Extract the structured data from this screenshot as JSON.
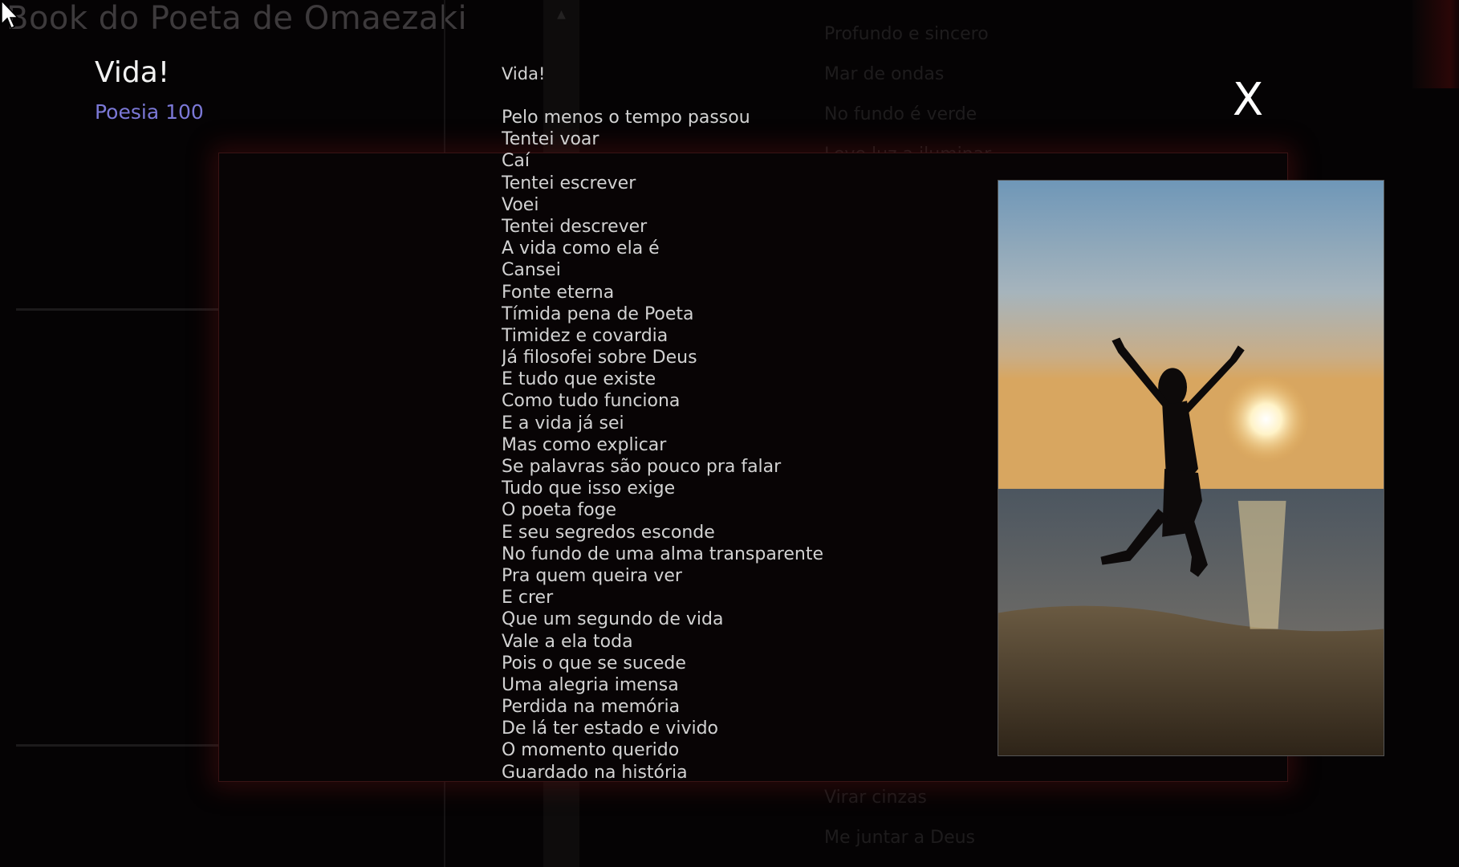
{
  "app": {
    "title": "Book do Poeta de Omaezaki"
  },
  "background_list": {
    "top_items": [
      "Profundo e sincero",
      "Mar de ondas",
      "No fundo é verde",
      "Leve luz a iluminar"
    ],
    "bottom_items": [
      "Virar cinzas",
      "Me juntar a Deus"
    ]
  },
  "post": {
    "title": "Vida!",
    "subtitle": "Poesia 100"
  },
  "modal": {
    "close_label": "X",
    "poem_title": "Vida!",
    "lines": [
      "Pelo menos o tempo passou",
      "Tentei voar",
      "Caí",
      "Tentei escrever",
      "Voei",
      "Tentei descrever",
      "A vida como ela é",
      "Cansei",
      "Fonte eterna",
      "Tímida pena de Poeta",
      "Timidez e covardia",
      "Já filosofei sobre Deus",
      "E tudo que existe",
      "Como tudo funciona",
      "E a vida já sei",
      "Mas como explicar",
      "Se palavras são pouco pra falar",
      "Tudo que isso exige",
      "O poeta foge",
      "E seu segredos esconde",
      "No fundo de uma alma transparente",
      "Pra quem queira ver",
      "E crer",
      "Que um segundo de vida",
      "Vale a ela toda",
      "Pois o que se sucede",
      "Uma alegria imensa",
      "Perdida na memória",
      "De lá ter estado e vivido",
      "O momento querido",
      "Guardado na história"
    ],
    "image": {
      "icon": "photo-sunset-beach-jump"
    }
  },
  "colors": {
    "background": "#050304",
    "subtitle": "#7b78d6",
    "modal_glow": "#6e1414"
  }
}
